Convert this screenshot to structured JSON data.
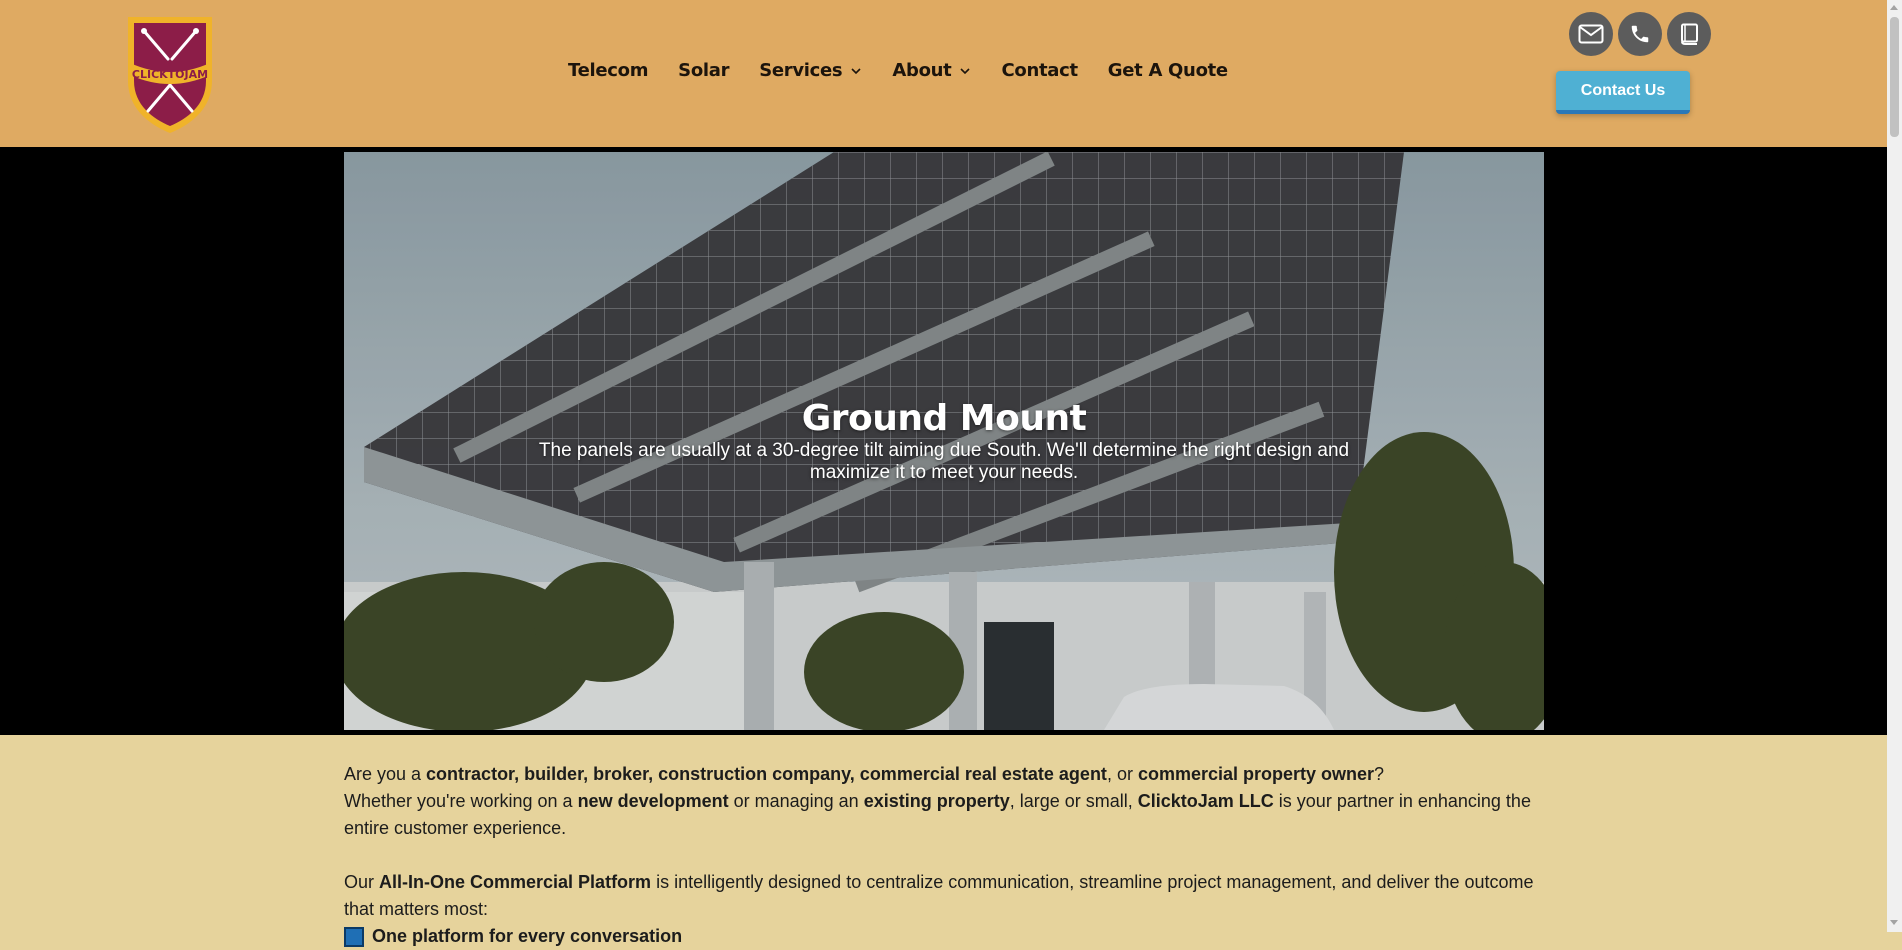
{
  "header": {
    "logo_text": "CLICKTOJAM",
    "nav": {
      "telecom": "Telecom",
      "solar": "Solar",
      "services": "Services",
      "about": "About",
      "contact": "Contact",
      "quote": "Get A Quote"
    },
    "icons": [
      "mail-icon",
      "phone-icon",
      "book-icon"
    ],
    "contact_button": "Contact Us"
  },
  "hero": {
    "title": "Ground Mount",
    "subtitle": "The panels are usually at a 30-degree tilt aiming due South. We'll determine the right design and maximize it to meet your needs."
  },
  "content": {
    "p1": [
      {
        "t": "Are you a ",
        "b": false
      },
      {
        "t": "contractor, builder, broker, construction company, commercial real estate agent",
        "b": true
      },
      {
        "t": ", or ",
        "b": false
      },
      {
        "t": "commercial property owner",
        "b": true
      },
      {
        "t": "?",
        "b": false
      },
      {
        "br": true
      },
      {
        "t": "Whether you're working on a ",
        "b": false
      },
      {
        "t": "new development",
        "b": true
      },
      {
        "t": " or managing an ",
        "b": false
      },
      {
        "t": "existing property",
        "b": true
      },
      {
        "t": ", large or small, ",
        "b": false
      },
      {
        "t": "ClicktoJam LLC",
        "b": true
      },
      {
        "t": " is your partner in enhancing the entire customer experience.",
        "b": false
      }
    ],
    "p2": [
      {
        "t": "Our ",
        "b": false
      },
      {
        "t": "All-In-One Commercial Platform",
        "b": true
      },
      {
        "t": " is intelligently designed to centralize communication, streamline project management, and deliver the outcome that matters most:",
        "b": false
      }
    ],
    "bullet1": "One platform for every conversation"
  },
  "colors": {
    "header_bg": "#dfaa62",
    "page_bg": "#e6d39c",
    "contact_button": "#4fb0d3",
    "icon_circle": "#5c5c5c",
    "logo_shield": "#8c1d48",
    "logo_border": "#f0b32a"
  }
}
